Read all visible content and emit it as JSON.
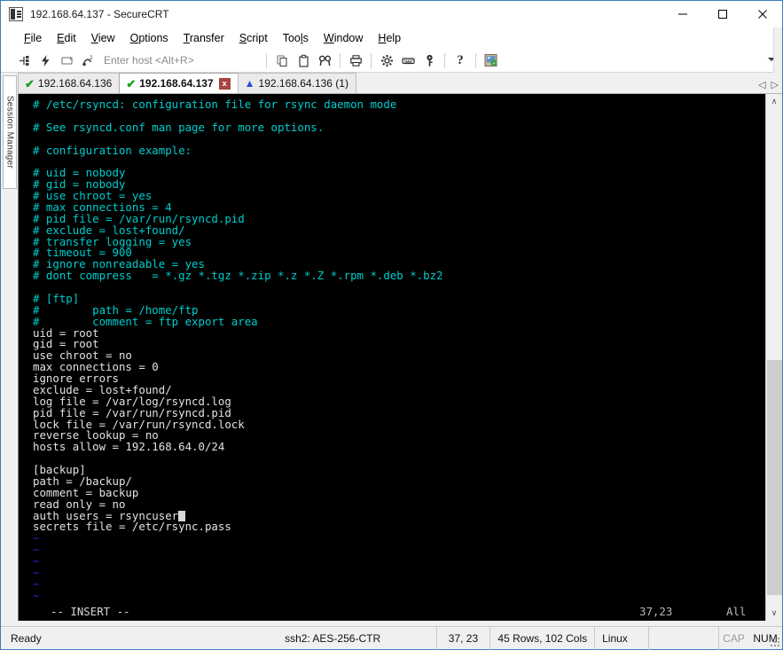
{
  "window": {
    "title": "192.168.64.137 - SecureCRT",
    "icon": "securecrt-app-icon",
    "minimize": "–",
    "maximize": "□",
    "close": "×"
  },
  "menubar": {
    "items": [
      {
        "label": "File",
        "accel": "F"
      },
      {
        "label": "Edit",
        "accel": "E"
      },
      {
        "label": "View",
        "accel": "V"
      },
      {
        "label": "Options",
        "accel": "O"
      },
      {
        "label": "Transfer",
        "accel": "T"
      },
      {
        "label": "Script",
        "accel": "S"
      },
      {
        "label": "Tools",
        "accel": "l"
      },
      {
        "label": "Window",
        "accel": "W"
      },
      {
        "label": "Help",
        "accel": "H"
      }
    ]
  },
  "toolbar": {
    "host_placeholder": "Enter host <Alt+R>",
    "icons": [
      "connect-icon",
      "quick-connect-icon",
      "reconnect-icon",
      "clone-session-icon",
      "copy-icon",
      "paste-icon",
      "find-icon",
      "print-icon",
      "session-options-icon",
      "keymap-editor-icon",
      "key-icon",
      "help-icon",
      "session-manager-icon"
    ],
    "overflow": "toolbar-overflow-caret"
  },
  "sidebar": {
    "label": "Session Manager"
  },
  "tabs": {
    "items": [
      {
        "label": "192.168.64.136",
        "status": "connected",
        "active": false,
        "closable": false
      },
      {
        "label": "192.168.64.137",
        "status": "connected",
        "active": true,
        "closable": true,
        "close_label": "x"
      },
      {
        "label": "192.168.64.136 (1)",
        "status": "warning",
        "active": false,
        "closable": false
      }
    ],
    "nav_prev": "◁",
    "nav_next": "▷"
  },
  "terminal": {
    "lines": [
      {
        "text": "# /etc/rsyncd: configuration file for rsync daemon mode",
        "color": "cyan"
      },
      {
        "text": "",
        "color": "white"
      },
      {
        "text": "# See rsyncd.conf man page for more options.",
        "color": "cyan"
      },
      {
        "text": "",
        "color": "white"
      },
      {
        "text": "# configuration example:",
        "color": "cyan"
      },
      {
        "text": "",
        "color": "white"
      },
      {
        "text": "# uid = nobody",
        "color": "cyan"
      },
      {
        "text": "# gid = nobody",
        "color": "cyan"
      },
      {
        "text": "# use chroot = yes",
        "color": "cyan"
      },
      {
        "text": "# max connections = 4",
        "color": "cyan"
      },
      {
        "text": "# pid file = /var/run/rsyncd.pid",
        "color": "cyan"
      },
      {
        "text": "# exclude = lost+found/",
        "color": "cyan"
      },
      {
        "text": "# transfer logging = yes",
        "color": "cyan"
      },
      {
        "text": "# timeout = 900",
        "color": "cyan"
      },
      {
        "text": "# ignore nonreadable = yes",
        "color": "cyan"
      },
      {
        "text": "# dont compress   = *.gz *.tgz *.zip *.z *.Z *.rpm *.deb *.bz2",
        "color": "cyan"
      },
      {
        "text": "",
        "color": "white"
      },
      {
        "text": "# [ftp]",
        "color": "cyan"
      },
      {
        "text": "#        path = /home/ftp",
        "color": "cyan"
      },
      {
        "text": "#        comment = ftp export area",
        "color": "cyan"
      },
      {
        "text": "uid = root",
        "color": "white"
      },
      {
        "text": "gid = root",
        "color": "white"
      },
      {
        "text": "use chroot = no",
        "color": "white"
      },
      {
        "text": "max connections = 0",
        "color": "white"
      },
      {
        "text": "ignore errors",
        "color": "white"
      },
      {
        "text": "exclude = lost+found/",
        "color": "white"
      },
      {
        "text": "log file = /var/log/rsyncd.log",
        "color": "white"
      },
      {
        "text": "pid file = /var/run/rsyncd.pid",
        "color": "white"
      },
      {
        "text": "lock file = /var/run/rsyncd.lock",
        "color": "white"
      },
      {
        "text": "reverse lookup = no",
        "color": "white"
      },
      {
        "text": "hosts allow = 192.168.64.0/24",
        "color": "white"
      },
      {
        "text": "",
        "color": "white"
      },
      {
        "text": "[backup]",
        "color": "white"
      },
      {
        "text": "path = /backup/",
        "color": "white"
      },
      {
        "text": "comment = backup",
        "color": "white"
      },
      {
        "text": "read only = no",
        "color": "white"
      },
      {
        "text": "auth users = rsyncuser",
        "color": "white",
        "cursor": true
      },
      {
        "text": "secrets file = /etc/rsync.pass",
        "color": "white"
      },
      {
        "text": "~",
        "color": "blue"
      },
      {
        "text": "~",
        "color": "blue"
      },
      {
        "text": "~",
        "color": "blue"
      },
      {
        "text": "~",
        "color": "blue"
      },
      {
        "text": "~",
        "color": "blue"
      },
      {
        "text": "~",
        "color": "blue"
      },
      {
        "text": "~",
        "color": "blue"
      }
    ],
    "status": {
      "mode": "-- INSERT --",
      "position": "37,23",
      "scroll": "All"
    },
    "scrollbar": {
      "up_arrow": "∧",
      "down_arrow": "∨"
    }
  },
  "statusbar": {
    "ready": "Ready",
    "cipher": "ssh2: AES-256-CTR",
    "position": "37,  23",
    "dimensions": "45 Rows, 102 Cols",
    "os": "Linux",
    "caps": "CAP",
    "num": "NUM"
  },
  "colors": {
    "accent": "#3a7ebf",
    "terminal_bg": "#000000",
    "terminal_cyan": "#00cdcd",
    "terminal_white": "#e2e2e2",
    "terminal_blue": "#2727d6",
    "tab_close_bg": "#a94442",
    "check_green": "#17a317"
  }
}
